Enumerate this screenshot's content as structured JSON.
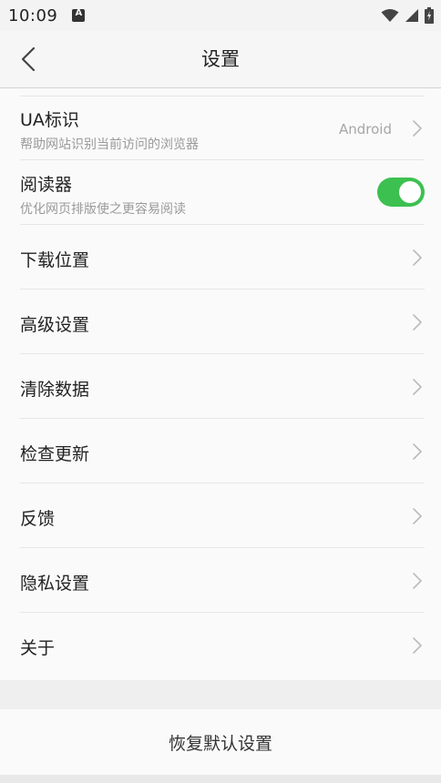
{
  "status_bar": {
    "time": "10:09",
    "notification_icon": "A"
  },
  "app_bar": {
    "title": "设置",
    "back_icon": "chevron-left-icon"
  },
  "settings": {
    "ua": {
      "title": "UA标识",
      "subtitle": "帮助网站识别当前访问的浏览器",
      "value": "Android"
    },
    "reader": {
      "title": "阅读器",
      "subtitle": "优化网页排版使之更容易阅读",
      "enabled": true
    },
    "items": [
      {
        "label": "下载位置"
      },
      {
        "label": "高级设置"
      },
      {
        "label": "清除数据"
      },
      {
        "label": "检查更新"
      },
      {
        "label": "反馈"
      },
      {
        "label": "隐私设置"
      },
      {
        "label": "关于"
      }
    ]
  },
  "footer": {
    "reset_label": "恢复默认设置"
  },
  "colors": {
    "toggle_on": "#3cc050",
    "background": "#fafafa",
    "secondary_text": "#9a9a9a"
  }
}
